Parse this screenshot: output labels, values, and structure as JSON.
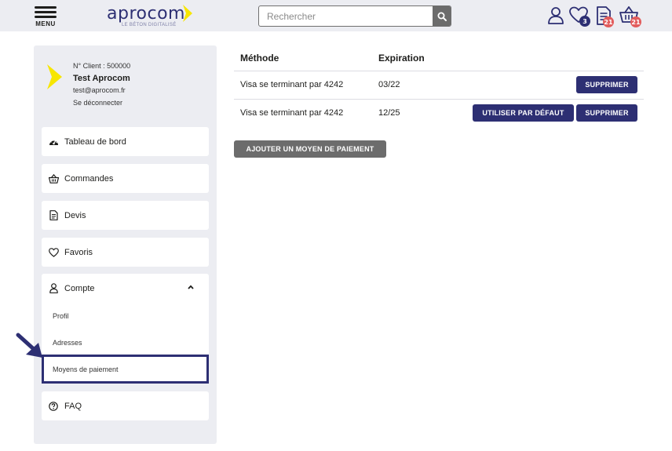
{
  "header": {
    "menu_label": "MENU",
    "logo_text": "aprocom",
    "logo_tagline": "LE BÉTON DIGITALISÉ",
    "search_placeholder": "Rechercher",
    "favorites_count": "3",
    "quotes_count": "21",
    "cart_count": "21",
    "icons": [
      "menu-icon",
      "search-icon",
      "user-icon",
      "heart-icon",
      "document-icon",
      "basket-icon"
    ]
  },
  "user": {
    "client_no": "N° Client : 500000",
    "name": "Test Aprocom",
    "email": "test@aprocom.fr",
    "logout": "Se déconnecter"
  },
  "sidebar": {
    "items": [
      {
        "label": "Tableau de bord",
        "icon": "dashboard-icon"
      },
      {
        "label": "Commandes",
        "icon": "basket-icon"
      },
      {
        "label": "Devis",
        "icon": "document-icon"
      },
      {
        "label": "Favoris",
        "icon": "heart-icon"
      }
    ],
    "compte": {
      "label": "Compte",
      "icon": "user-icon",
      "expanded": true,
      "subitems": [
        "Profil",
        "Adresses",
        "Moyens de paiement"
      ],
      "active": "Moyens de paiement"
    },
    "faq": {
      "label": "FAQ",
      "icon": "question-icon"
    }
  },
  "payments": {
    "columns": [
      "Méthode",
      "Expiration"
    ],
    "rows": [
      {
        "method": "Visa se terminant par 4242",
        "expiration": "03/22",
        "is_default": true,
        "delete_label": "SUPPRIMER"
      },
      {
        "method": "Visa se terminant par 4242",
        "expiration": "12/25",
        "is_default": false,
        "default_label": "UTILISER PAR DÉFAUT",
        "delete_label": "SUPPRIMER"
      }
    ],
    "add_label": "AJOUTER UN MOYEN DE PAIEMENT"
  },
  "colors": {
    "navy": "#2d2f73",
    "yellow": "#f7e600",
    "light_bg": "#ecedf2",
    "badge_red": "#e25c5c",
    "gray_button": "#6c6c6c"
  }
}
